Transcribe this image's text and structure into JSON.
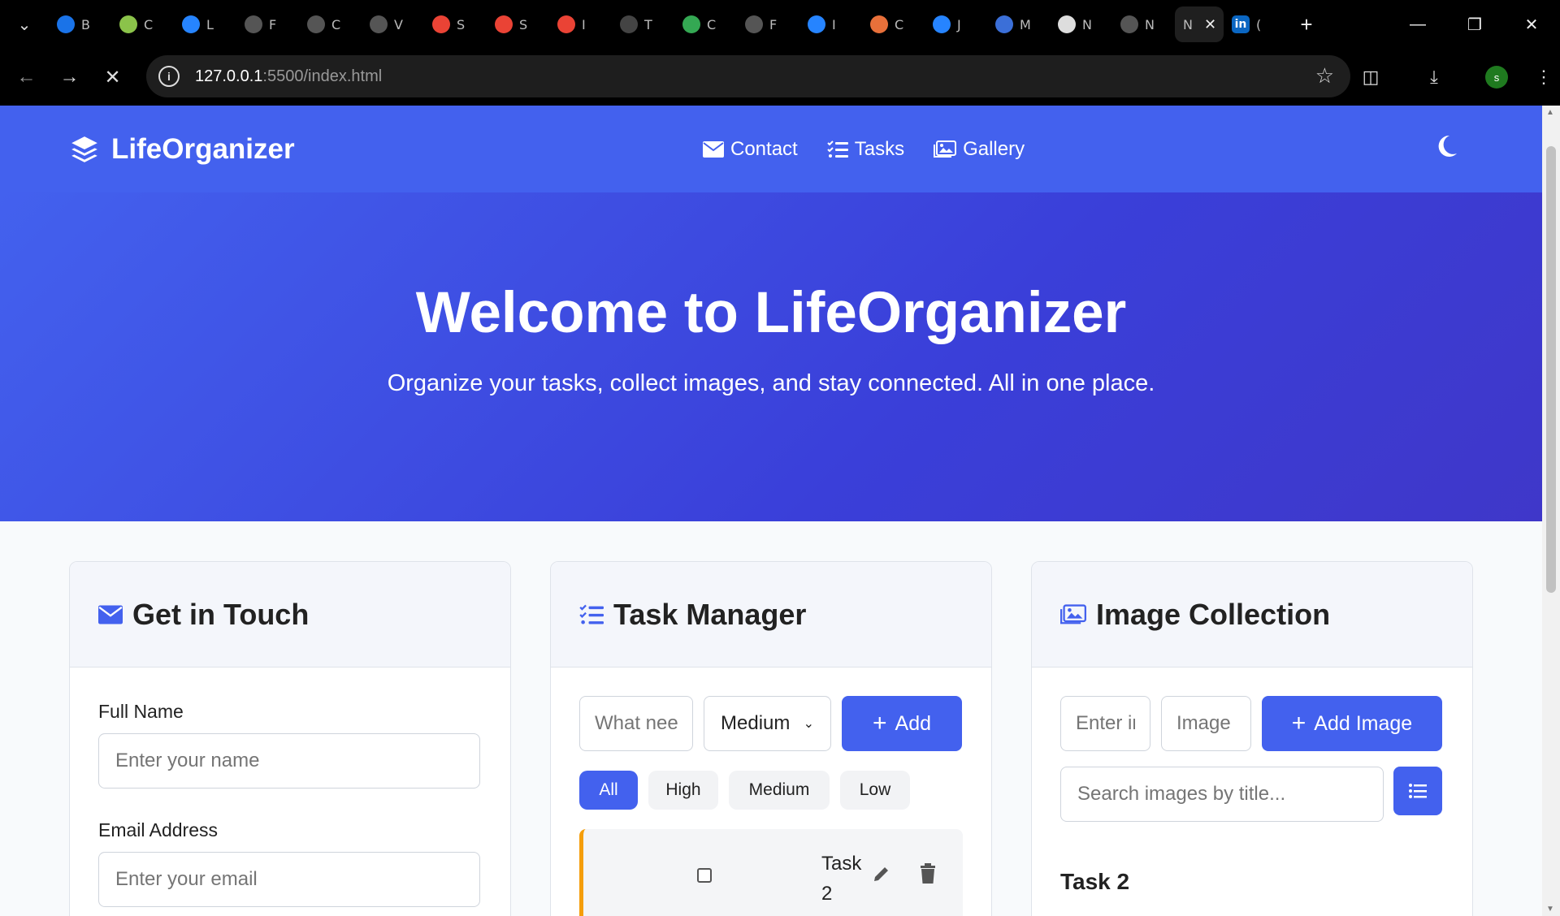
{
  "browser": {
    "tabs": [
      {
        "letter": "B",
        "icon": "info-favicon",
        "color": "#1a73e8"
      },
      {
        "letter": "C",
        "icon": "swirl-favicon",
        "color": "#8bc34a"
      },
      {
        "letter": "L",
        "icon": "jira-favicon",
        "color": "#2684ff"
      },
      {
        "letter": "F",
        "icon": "openai-favicon",
        "color": "#555555"
      },
      {
        "letter": "C",
        "icon": "aperture-favicon",
        "color": "#555555"
      },
      {
        "letter": "V",
        "icon": "globe-favicon",
        "color": "#555555"
      },
      {
        "letter": "S",
        "icon": "gmail-favicon",
        "color": "#ea4335"
      },
      {
        "letter": "S",
        "icon": "gmail-favicon",
        "color": "#ea4335"
      },
      {
        "letter": "I",
        "icon": "gmail-favicon",
        "color": "#ea4335"
      },
      {
        "letter": "T",
        "icon": "github-favicon",
        "color": "#444444"
      },
      {
        "letter": "C",
        "icon": "meet-favicon",
        "color": "#34a853"
      },
      {
        "letter": "F",
        "icon": "globe-favicon",
        "color": "#555555"
      },
      {
        "letter": "I",
        "icon": "jira-favicon",
        "color": "#2684ff"
      },
      {
        "letter": "C",
        "icon": "claude-favicon",
        "color": "#e8703a"
      },
      {
        "letter": "J",
        "icon": "jira-favicon",
        "color": "#2684ff"
      },
      {
        "letter": "M",
        "icon": "edge-favicon",
        "color": "#3b6fd8"
      },
      {
        "letter": "N",
        "icon": "chrome-favicon",
        "color": "#dddddd"
      },
      {
        "letter": "N",
        "icon": "globe-favicon",
        "color": "#555555"
      }
    ],
    "active_tab": {
      "letter": "N"
    },
    "last_tab": {
      "letter": "(",
      "icon": "linkedin-favicon",
      "color": "#0a66c2"
    },
    "url_host": "127.0.0.1",
    "url_path": ":5500/index.html",
    "profile_initial": "s"
  },
  "site": {
    "brand": "LifeOrganizer",
    "nav": {
      "contact": "Contact",
      "tasks": "Tasks",
      "gallery": "Gallery"
    },
    "hero": {
      "title": "Welcome to LifeOrganizer",
      "subtitle": "Organize your tasks, collect images, and stay connected. All in one place."
    },
    "contact": {
      "title": "Get in Touch",
      "name_label": "Full Name",
      "name_placeholder": "Enter your name",
      "email_label": "Email Address",
      "email_placeholder": "Enter your email"
    },
    "tasks": {
      "title": "Task Manager",
      "input_placeholder": "What needs to be done?",
      "priority_selected": "Medium",
      "add_label": "Add",
      "filters": [
        "All",
        "High",
        "Medium",
        "Low"
      ],
      "active_filter": "All",
      "items": [
        {
          "text": "Task 2",
          "priority": "Medium",
          "done": false
        }
      ]
    },
    "images": {
      "title": "Image Collection",
      "title_placeholder": "Enter image title",
      "url_placeholder": "Image URL",
      "add_label": "Add Image",
      "search_placeholder": "Search images by title...",
      "first_item_title": "Task 2"
    },
    "colors": {
      "primary": "#4361ee",
      "priority_medium": "#f59e0b"
    }
  }
}
